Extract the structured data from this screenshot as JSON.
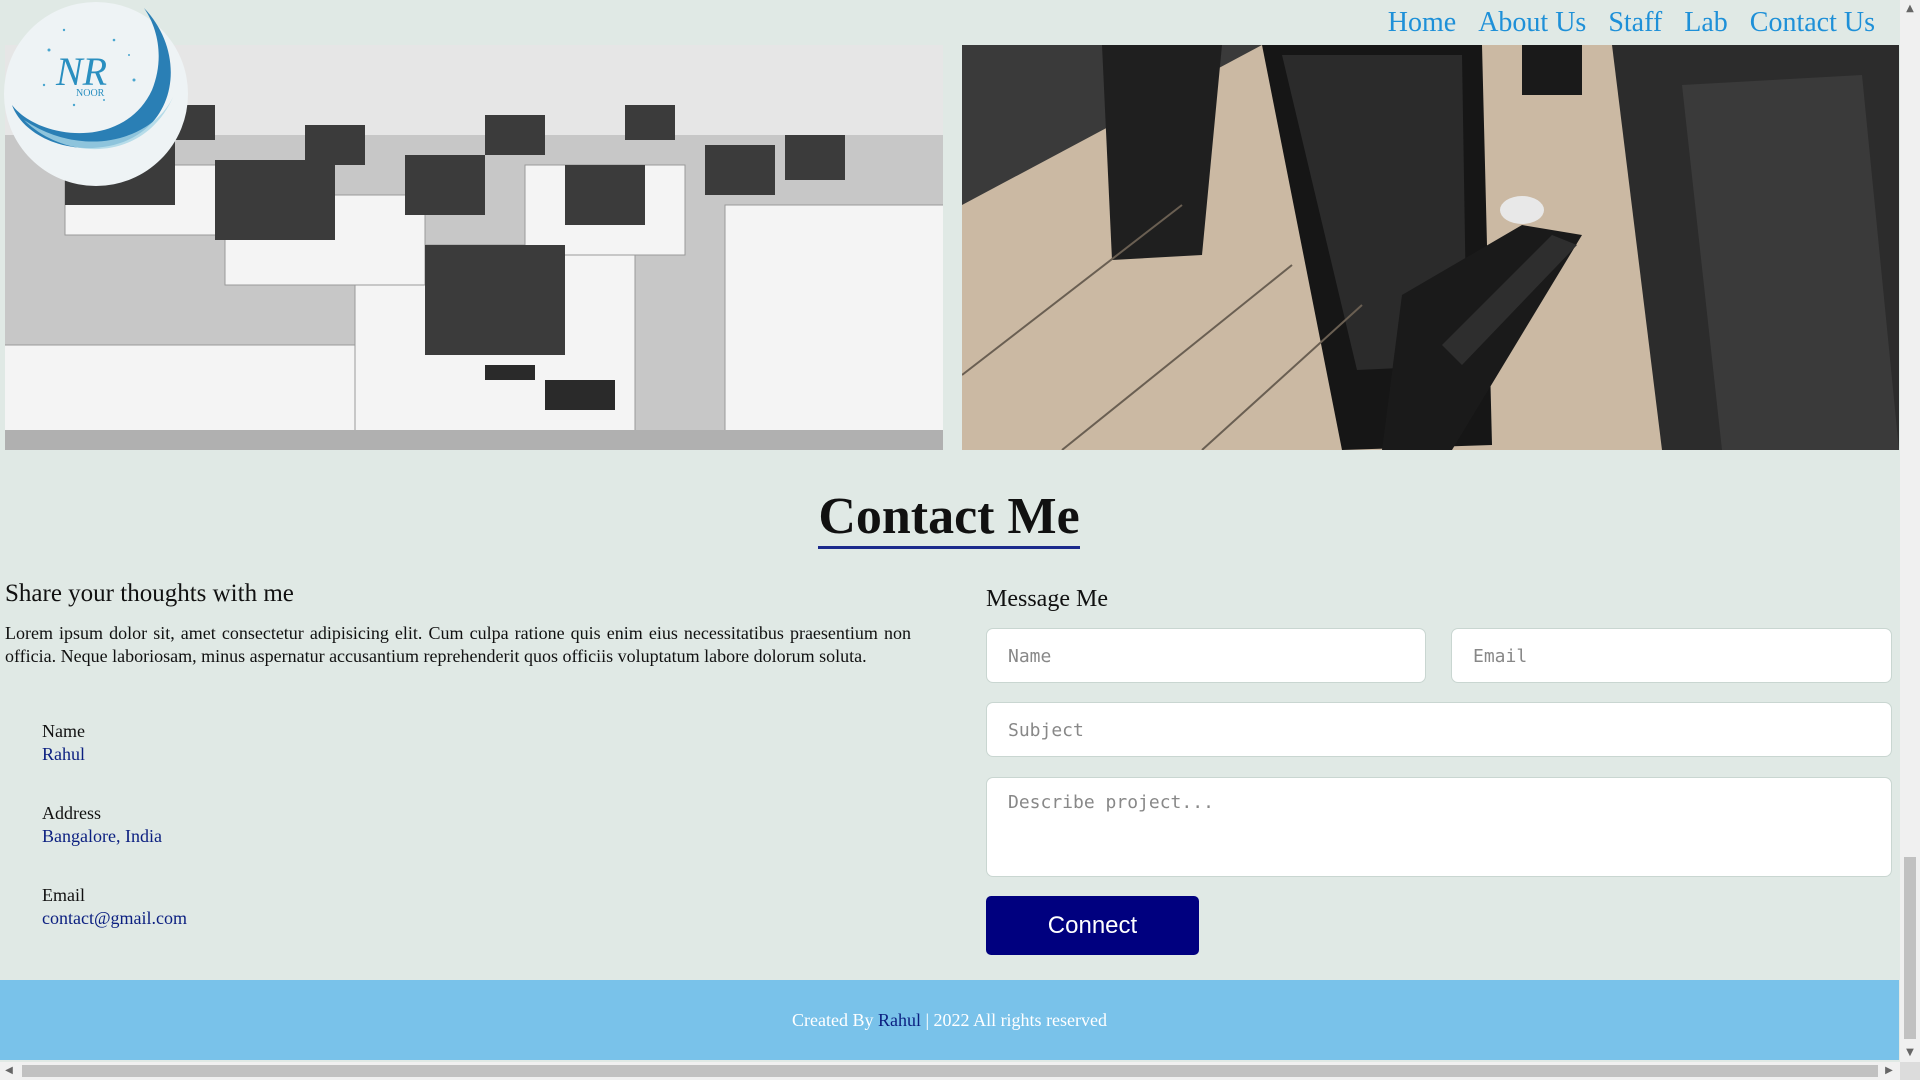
{
  "nav": {
    "items": [
      "Home",
      "About Us",
      "Staff",
      "Lab",
      "Contact Us"
    ]
  },
  "logo": {
    "main": "NR",
    "sub": "NOOR"
  },
  "contact": {
    "title": "Contact Me",
    "share_heading": "Share your thoughts with me",
    "lorem": "Lorem ipsum dolor sit, amet consectetur adipisicing elit. Cum culpa ratione quis enim eius necessitatibus praesentium non officia. Neque laboriosam, minus aspernatur accusantium reprehenderit quos officiis voluptatum labore dolorum soluta.",
    "info": [
      {
        "label": "Name",
        "value": "Rahul"
      },
      {
        "label": "Address",
        "value": "Bangalore, India"
      },
      {
        "label": "Email",
        "value": "contact@gmail.com"
      }
    ]
  },
  "form": {
    "heading": "Message Me",
    "name_placeholder": "Name",
    "email_placeholder": "Email",
    "subject_placeholder": "Subject",
    "project_placeholder": "Describe project...",
    "button": "Connect"
  },
  "footer": {
    "prefix": "Created By ",
    "name": "Rahul",
    "suffix": " | 2022 All rights reserved"
  },
  "colors": {
    "background": "#e0e9e5",
    "nav_link": "#1e90d8",
    "accent_dark": "#00007f",
    "footer": "#79c2ea"
  }
}
